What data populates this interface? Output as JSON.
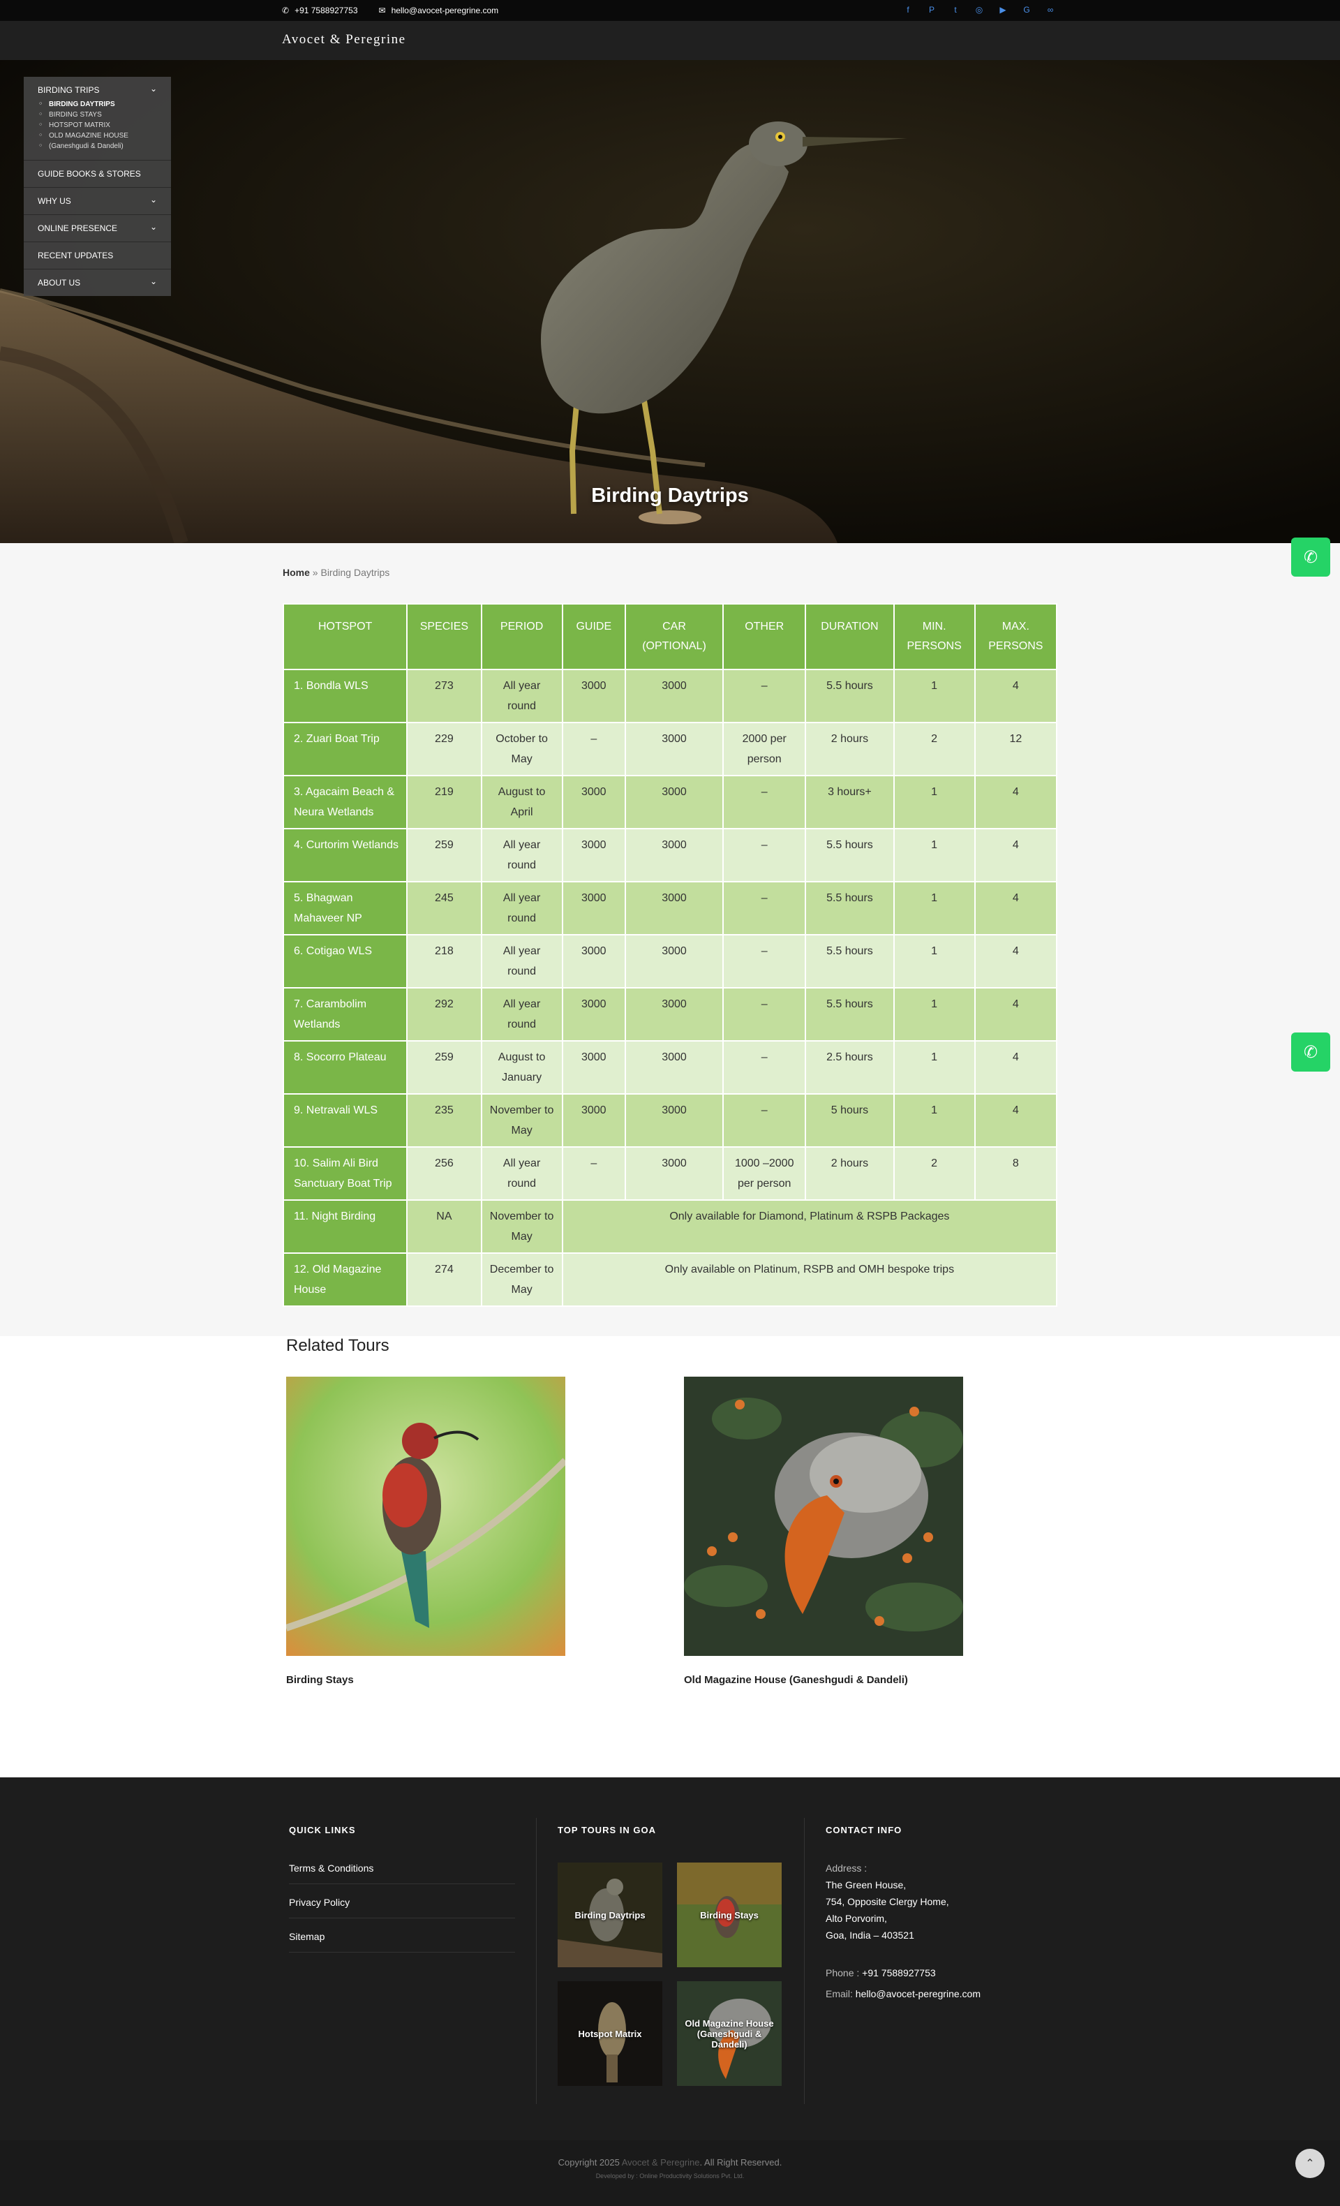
{
  "topbar": {
    "phone": "+91 7588927753",
    "email": "hello@avocet-peregrine.com",
    "social": [
      "f",
      "P",
      "t",
      "◎",
      "▶",
      "G",
      "∞"
    ]
  },
  "header": {
    "logo": "Avocet & Peregrine"
  },
  "hero": {
    "title": "Birding Daytrips"
  },
  "sidemenu": {
    "items": [
      {
        "label": "BIRDING TRIPS"
      },
      {
        "label": "GUIDE BOOKS & STORES"
      },
      {
        "label": "WHY US"
      },
      {
        "label": "ONLINE PRESENCE"
      },
      {
        "label": "RECENT UPDATES"
      },
      {
        "label": "ABOUT US"
      }
    ],
    "submenu": [
      "BIRDING DAYTRIPS",
      "BIRDING STAYS",
      "HOTSPOT MATRIX",
      "OLD MAGAZINE HOUSE",
      "(Ganeshgudi & Dandeli)"
    ]
  },
  "breadcrumb": {
    "home": "Home",
    "sep": " » ",
    "current": "Birding Daytrips"
  },
  "table": {
    "headers": [
      "HOTSPOT",
      "SPECIES",
      "PERIOD",
      "GUIDE",
      "CAR (OPTIONAL)",
      "OTHER",
      "DURATION",
      "MIN. PERSONS",
      "MAX. PERSONS"
    ],
    "rows": [
      [
        "1. Bondla WLS",
        "273",
        "All year round",
        "3000",
        "3000",
        "–",
        "5.5 hours",
        "1",
        "4"
      ],
      [
        "2. Zuari Boat Trip",
        "229",
        "October to May",
        "–",
        "3000",
        "2000 per person",
        "2 hours",
        "2",
        "12"
      ],
      [
        "3. Agacaim Beach & Neura Wetlands",
        "219",
        "August to April",
        "3000",
        "3000",
        "–",
        "3 hours+",
        "1",
        "4"
      ],
      [
        "4. Curtorim Wetlands",
        "259",
        "All year round",
        "3000",
        "3000",
        "–",
        "5.5 hours",
        "1",
        "4"
      ],
      [
        "5. Bhagwan Mahaveer NP",
        "245",
        "All year round",
        "3000",
        "3000",
        "–",
        "5.5 hours",
        "1",
        "4"
      ],
      [
        "6. Cotigao WLS",
        "218",
        "All year round",
        "3000",
        "3000",
        "–",
        "5.5 hours",
        "1",
        "4"
      ],
      [
        "7. Carambolim Wetlands",
        "292",
        "All year round",
        "3000",
        "3000",
        "–",
        "5.5 hours",
        "1",
        "4"
      ],
      [
        "8. Socorro Plateau",
        "259",
        "August to January",
        "3000",
        "3000",
        "–",
        "2.5 hours",
        "1",
        "4"
      ],
      [
        "9. Netravali WLS",
        "235",
        "November to May",
        "3000",
        "3000",
        "–",
        "5 hours",
        "1",
        "4"
      ],
      [
        "10. Salim Ali Bird Sanctuary Boat Trip",
        "256",
        "All year round",
        "–",
        "3000",
        "1000 –2000 per person",
        "2 hours",
        "2",
        "8"
      ]
    ],
    "special": [
      {
        "hotspot": "11. Night Birding",
        "species": "NA",
        "period": "November to May",
        "note": "Only available for Diamond, Platinum & RSPB Packages"
      },
      {
        "hotspot": "12. Old Magazine House",
        "species": "274",
        "period": "December to May",
        "note": "Only available on Platinum, RSPB and OMH bespoke trips"
      }
    ]
  },
  "related": {
    "title": "Related Tours",
    "cards": [
      "Birding Stays",
      "Old Magazine House (Ganeshgudi & Dandeli)"
    ]
  },
  "footer": {
    "quick_links_title": "QUICK LINKS",
    "quick_links": [
      "Terms & Conditions",
      "Privacy Policy",
      "Sitemap"
    ],
    "top_tours_title": "TOP TOURS IN GOA",
    "top_tours": [
      "Birding Daytrips",
      "Birding Stays",
      "Hotspot Matrix",
      "Old Magazine House (Ganeshgudi & Dandeli)"
    ],
    "contact_title": "CONTACT INFO",
    "address_label": "Address :",
    "address_lines": [
      "The Green House,",
      "754, Opposite Clergy Home,",
      "Alto Porvorim,",
      "Goa, India – 403521"
    ],
    "phone_label": "Phone : ",
    "phone": "+91 7588927753",
    "email_label": "Email: ",
    "email": "hello@avocet-peregrine.com",
    "copyright_pre": "Copyright 2025 ",
    "copyright_brand": "Avocet & Peregrine",
    "copyright_post": ". All Right Reserved.",
    "developed_by": "Developed by : Online Productivity Solutions Pvt. Ltd."
  },
  "colors": {
    "table_green": "#7ab648",
    "row_dark": "#c2de9d",
    "row_light": "#e0efcf",
    "whatsapp": "#25d366",
    "footer_bg": "#1d1d1d"
  }
}
